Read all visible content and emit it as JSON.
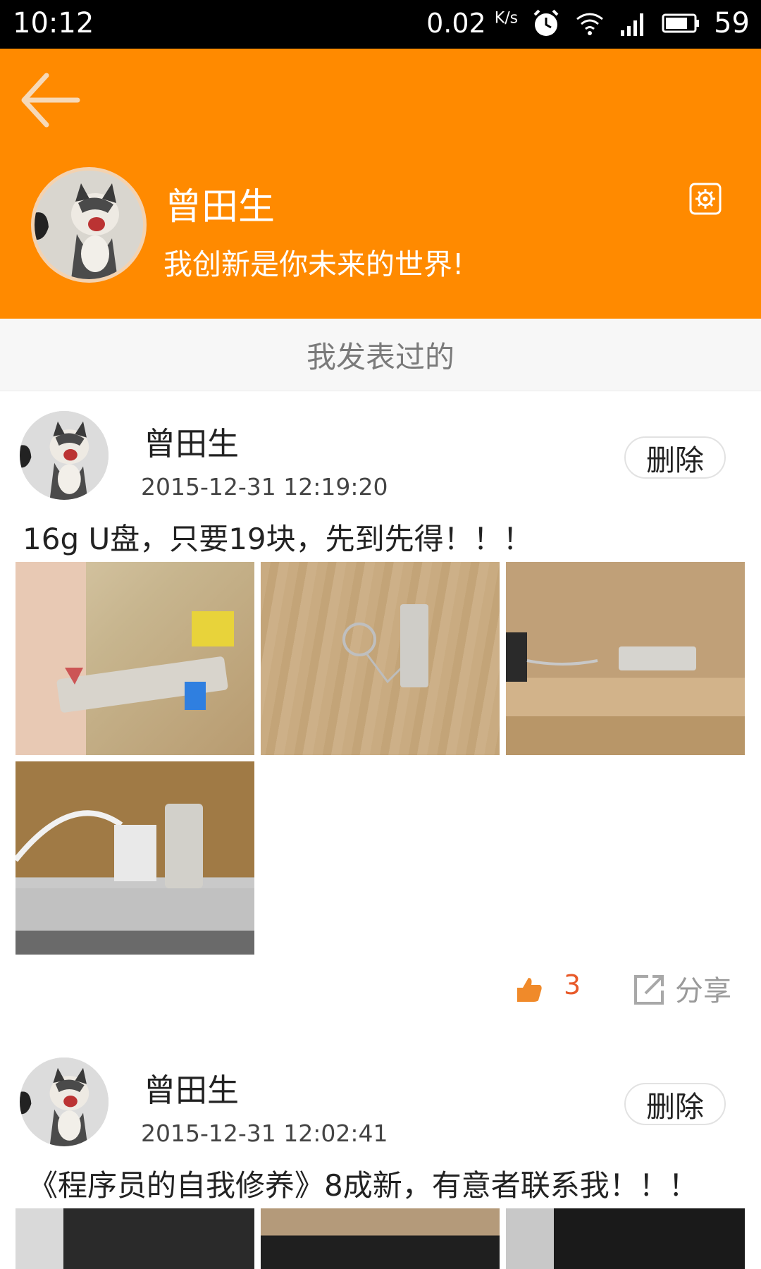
{
  "status_bar": {
    "time": "10:12",
    "speed": "0.02",
    "speed_unit": "K/s",
    "battery": "59"
  },
  "header": {
    "back_icon": "arrow-left-icon",
    "name": "曾田生",
    "motto": "我创新是你未来的世界!",
    "settings_icon": "gear-icon",
    "color": "#ff8a00"
  },
  "section": {
    "title": "我发表过的"
  },
  "posts": [
    {
      "author": "曾田生",
      "time": "2015-12-31 12:19:20",
      "delete_label": "删除",
      "text": "16g U盘，只要19块，先到先得！！！",
      "like_count": "3",
      "share_label": "分享"
    },
    {
      "author": "曾田生",
      "time": "2015-12-31 12:02:41",
      "delete_label": "删除",
      "text": "《程序员的自我修养》8成新，有意者联系我！！！"
    }
  ],
  "colors": {
    "accent": "#ff8a00",
    "like": "#e85a2a",
    "muted": "#9a9a9a"
  }
}
